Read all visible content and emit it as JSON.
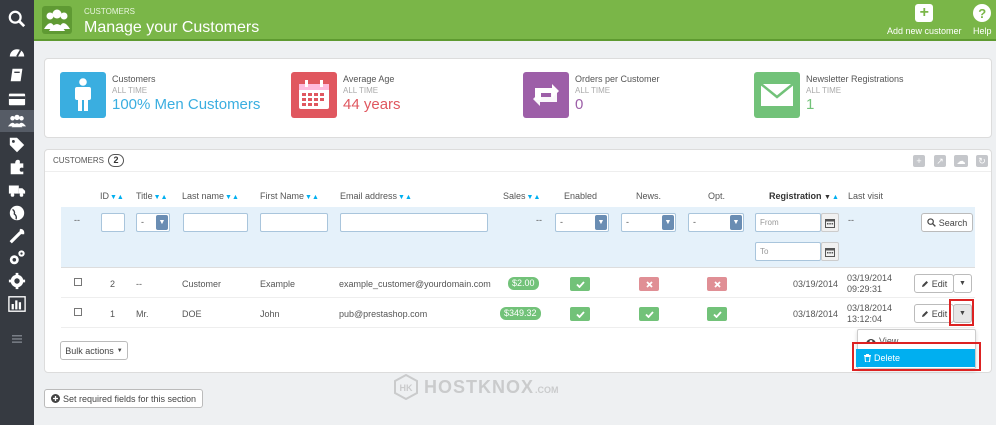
{
  "header": {
    "breadcrumb": "Customers",
    "title": "Manage your Customers",
    "add_label": "Add new customer",
    "help_label": "Help"
  },
  "kpis": [
    {
      "title": "Customers",
      "period": "ALL TIME",
      "value": "100% Men Customers",
      "color": "#3aaee0"
    },
    {
      "title": "Average Age",
      "period": "ALL TIME",
      "value": "44 years",
      "color": "#e0575f"
    },
    {
      "title": "Orders per Customer",
      "period": "ALL TIME",
      "value": "0",
      "color": "#9d5fa8"
    },
    {
      "title": "Newsletter Registrations",
      "period": "ALL TIME",
      "value": "1",
      "color": "#72c279"
    }
  ],
  "panel": {
    "title": "CUSTOMERS",
    "count": "2"
  },
  "columns": {
    "id": "ID",
    "title": "Title",
    "last_name": "Last name",
    "first_name": "First Name",
    "email": "Email address",
    "sales": "Sales",
    "enabled": "Enabled",
    "news": "News.",
    "opt": "Opt.",
    "registration": "Registration",
    "last_visit": "Last visit"
  },
  "filters": {
    "dash": "--",
    "select_value": "-",
    "from_placeholder": "From",
    "to_placeholder": "To",
    "search_label": "Search"
  },
  "rows": [
    {
      "id": "2",
      "title": "--",
      "last_name": "Customer",
      "first_name": "Example",
      "email": "example_customer@yourdomain.com",
      "sales": "$2.00",
      "enabled": "check",
      "news": "cross",
      "opt": "cross",
      "registration": "03/19/2014",
      "last_visit_date": "03/19/2014",
      "last_visit_time": "09:29:31"
    },
    {
      "id": "1",
      "title": "Mr.",
      "last_name": "DOE",
      "first_name": "John",
      "email": "pub@prestashop.com",
      "sales": "$349.32",
      "enabled": "check",
      "news": "check",
      "opt": "check",
      "registration": "03/18/2014",
      "last_visit_date": "03/18/2014",
      "last_visit_time": "13:12:04"
    }
  ],
  "actions": {
    "edit_label": "Edit",
    "view_label": "View",
    "delete_label": "Delete"
  },
  "bulk_label": "Bulk actions",
  "required_fields_label": "Set required fields for this section",
  "watermark": {
    "name": "HOSTKNOX",
    "suffix": ".COM"
  }
}
